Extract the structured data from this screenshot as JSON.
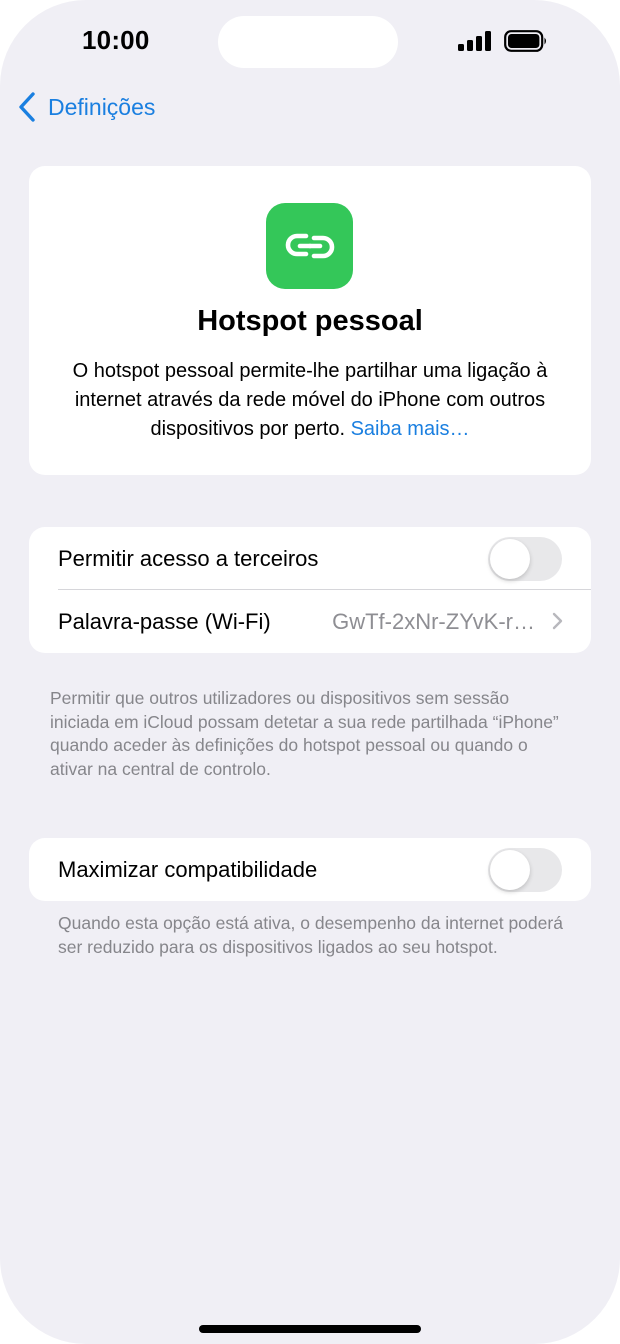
{
  "status_bar": {
    "time": "10:00",
    "signal_icon": "cellular-signal-icon",
    "battery_icon": "battery-icon"
  },
  "nav": {
    "back_label": "Definições",
    "back_icon": "chevron-left-icon"
  },
  "hero": {
    "icon": "link-icon",
    "icon_color": "#34c759",
    "title": "Hotspot pessoal",
    "description": "O hotspot pessoal permite-lhe partilhar uma ligação à internet através da rede móvel do iPhone com outros dispositivos por perto.",
    "link_label": "Saiba mais…"
  },
  "settings": {
    "allow_others": {
      "label": "Permitir acesso a terceiros",
      "enabled": false
    },
    "wifi_password": {
      "label": "Palavra-passe (Wi-Fi)",
      "value": "GwTf-2xNr-ZYvK-r…",
      "chevron_icon": "chevron-right-icon"
    },
    "allow_others_footer": "Permitir que outros utilizadores ou dispositivos sem sessão iniciada em iCloud possam detetar a sua rede partilhada “iPhone” quando aceder às definições do hotspot pessoal ou quando o ativar na central de controlo.",
    "maximize_compat": {
      "label": "Maximizar compatibilidade",
      "enabled": false
    },
    "maximize_compat_footer": "Quando esta opção está ativa, o desempenho da internet poderá ser reduzido para os dispositivos ligados ao seu hotspot."
  },
  "colors": {
    "accent": "#1a7fe0",
    "background": "#f0eff5",
    "toggle_off": "#e8e8ea"
  }
}
